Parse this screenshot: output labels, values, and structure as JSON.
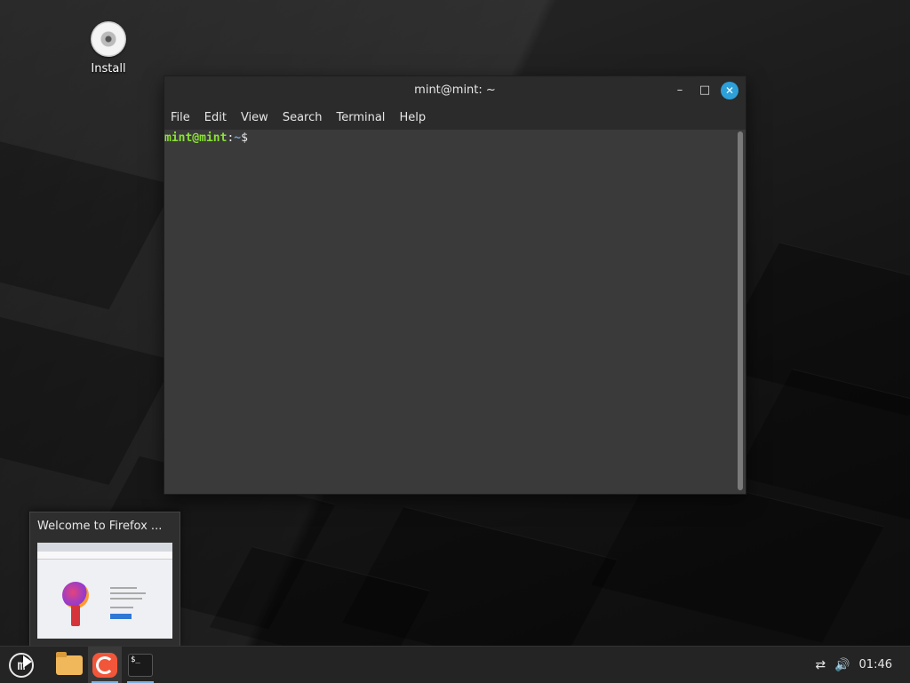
{
  "desktop": {
    "icon_install_label": "Install"
  },
  "terminal": {
    "title": "mint@mint: ~",
    "menu": [
      "File",
      "Edit",
      "View",
      "Search",
      "Terminal",
      "Help"
    ],
    "prompt_user": "mint@mint",
    "prompt_colon": ":",
    "prompt_path": "~",
    "prompt_symbol": "$",
    "window_controls": {
      "minimize": "–",
      "maximize": "□",
      "close": "✕"
    }
  },
  "preview": {
    "title": "Welcome to Firefox ..."
  },
  "taskbar": {
    "menu_icon": "linux-mint-logo-icon",
    "apps": [
      {
        "name": "Files",
        "icon": "folder-icon"
      },
      {
        "name": "Firefox",
        "icon": "firefox-icon"
      },
      {
        "name": "Terminal",
        "icon": "terminal-icon",
        "glyph": "$_"
      }
    ],
    "tray": {
      "network_icon": "network-disconnected-icon",
      "volume_icon": "volume-icon",
      "clock": "01:46"
    }
  },
  "colors": {
    "close_button": "#2d9fd9",
    "prompt_user": "#8ae234",
    "prompt_path": "#729fcf"
  }
}
